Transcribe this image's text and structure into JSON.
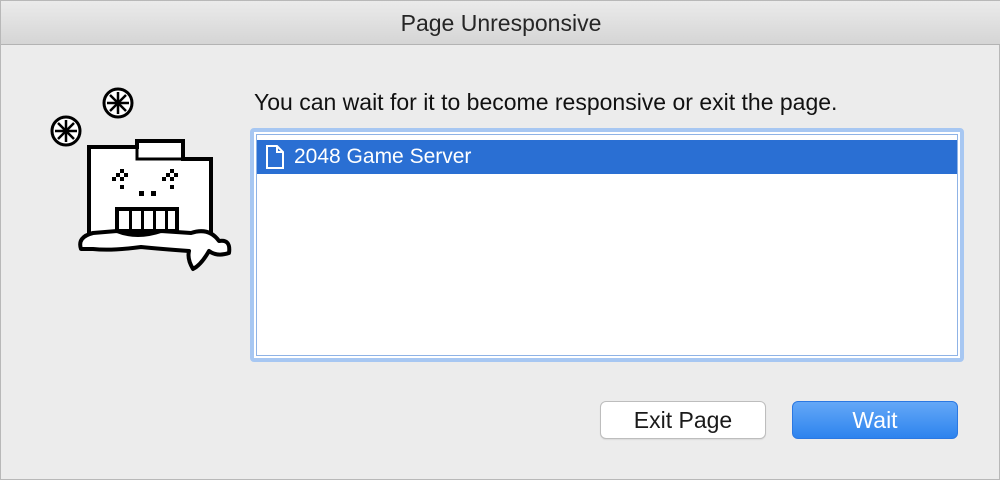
{
  "window": {
    "title": "Page Unresponsive"
  },
  "dialog": {
    "message": "You can wait for it to become responsive or exit the page.",
    "pages": [
      {
        "label": "2048 Game Server",
        "icon": "document-icon",
        "selected": true
      }
    ]
  },
  "buttons": {
    "exit_label": "Exit Page",
    "wait_label": "Wait"
  },
  "colors": {
    "selection": "#2a6fd3",
    "focus_ring": "#a7c7f2",
    "primary_button": "#3a8bf0",
    "background": "#ececec"
  },
  "icons": {
    "mascot": "frozen-folder-mascot-icon",
    "snowflake": "snowflake-icon"
  }
}
